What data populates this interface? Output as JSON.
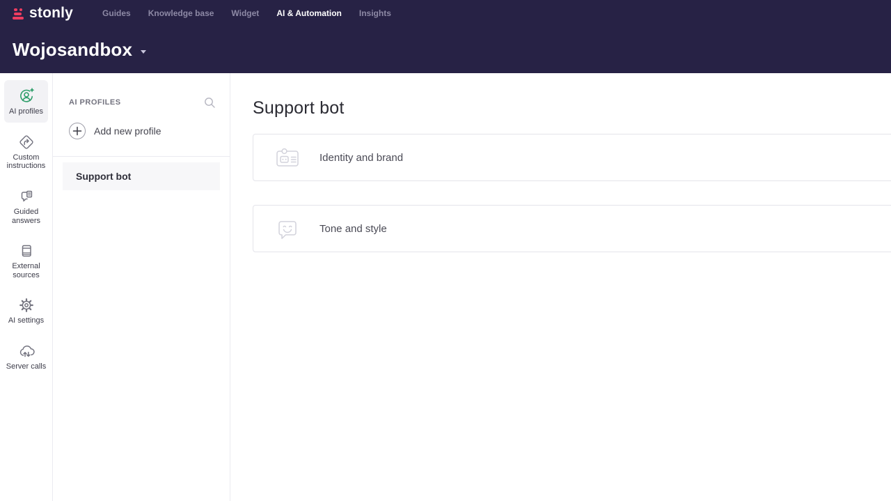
{
  "header": {
    "brand": "stonly",
    "nav": [
      {
        "label": "Guides"
      },
      {
        "label": "Knowledge base"
      },
      {
        "label": "Widget"
      },
      {
        "label": "AI & Automation"
      },
      {
        "label": "Insights"
      }
    ],
    "workspace": "Wojosandbox"
  },
  "sidebar": {
    "items": [
      {
        "label": "AI profiles",
        "icon": "ai-profiles-icon",
        "active": true
      },
      {
        "label": "Custom instructions",
        "icon": "custom-instructions-icon",
        "active": false
      },
      {
        "label": "Guided answers",
        "icon": "guided-answers-icon",
        "active": false
      },
      {
        "label": "External sources",
        "icon": "external-sources-icon",
        "active": false
      },
      {
        "label": "AI settings",
        "icon": "ai-settings-icon",
        "active": false
      },
      {
        "label": "Server calls",
        "icon": "server-calls-icon",
        "active": false
      }
    ]
  },
  "profiles_panel": {
    "title": "AI PROFILES",
    "search_icon": "search-icon",
    "add_button_label": "Add new profile",
    "profiles": [
      {
        "label": "Support bot",
        "selected": true
      }
    ]
  },
  "main": {
    "title": "Support bot",
    "cards": [
      {
        "label": "Identity and brand",
        "icon": "id-badge-icon"
      },
      {
        "label": "Tone and style",
        "icon": "chat-smile-icon"
      }
    ]
  },
  "colors": {
    "header_bg": "#272245",
    "brand_pink": "#ee3d60",
    "accent_green": "#2f9e6a",
    "flag_blue": "#0057b7",
    "flag_yellow": "#ffd700",
    "border": "#ebebf0"
  }
}
